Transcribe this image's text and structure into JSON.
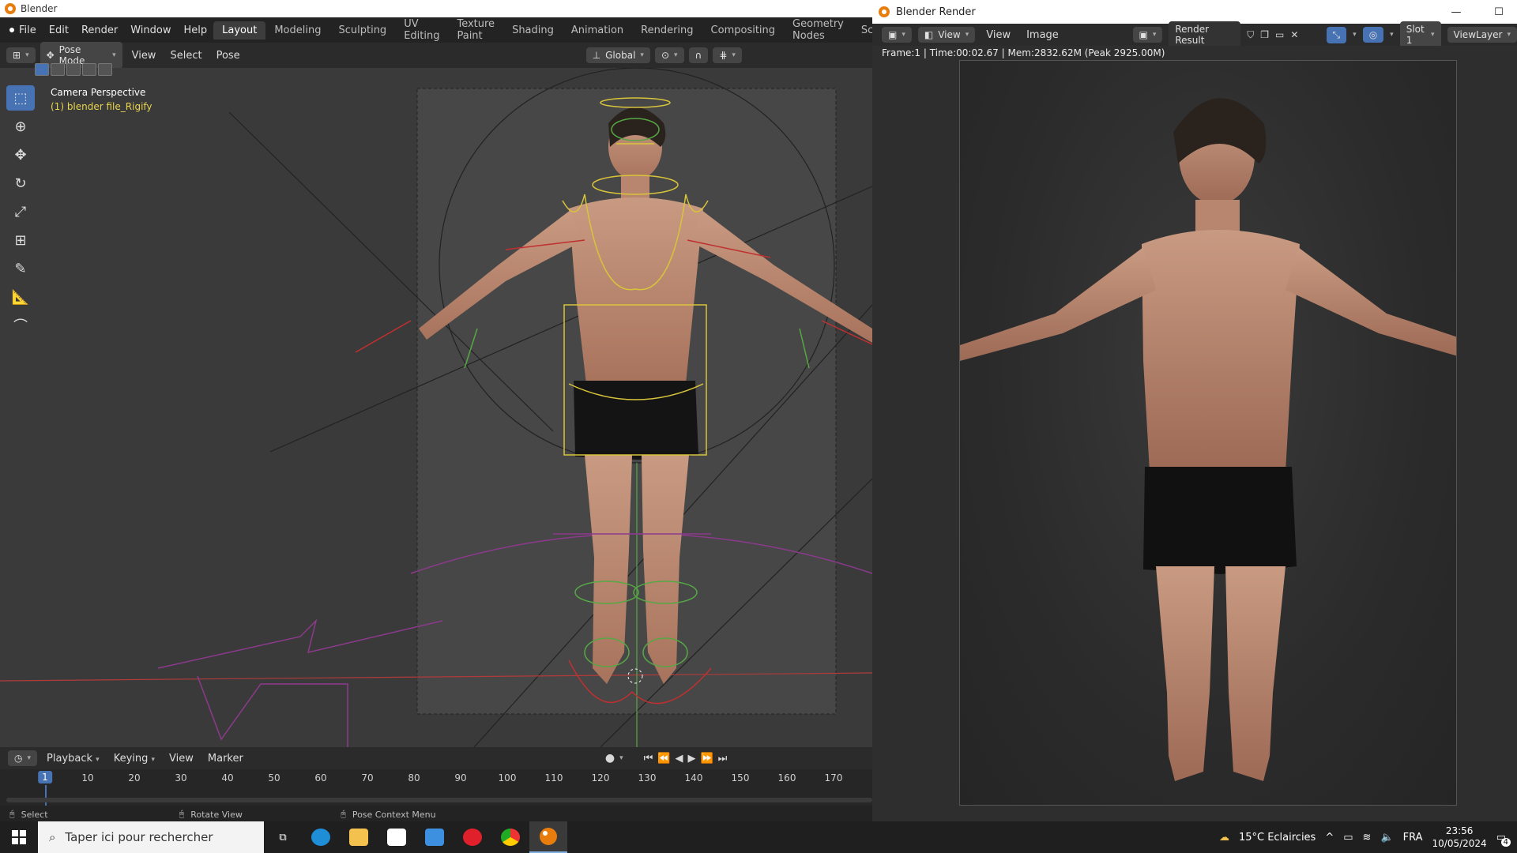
{
  "os_window": {
    "title": "Blender"
  },
  "topbar": {
    "menus": [
      "File",
      "Edit",
      "Render",
      "Window",
      "Help"
    ],
    "workspaces": [
      "Layout",
      "Modeling",
      "Sculpting",
      "UV Editing",
      "Texture Paint",
      "Shading",
      "Animation",
      "Rendering",
      "Compositing",
      "Geometry Nodes",
      "Scripting"
    ],
    "active_workspace": "Layout",
    "add_tab": "+"
  },
  "viewport_header": {
    "mode": "Pose Mode",
    "menus": [
      "View",
      "Select",
      "Pose"
    ],
    "transform_orientation": "Global"
  },
  "viewport": {
    "camera_label": "Camera Perspective",
    "object_label": "(1) blender file_Rigify"
  },
  "timeline": {
    "menus": [
      "Playback",
      "Keying",
      "View",
      "Marker"
    ],
    "current_frame": "1",
    "ticks": [
      "10",
      "20",
      "30",
      "40",
      "50",
      "60",
      "70",
      "80",
      "90",
      "100",
      "110",
      "120",
      "130",
      "140",
      "150",
      "160",
      "170"
    ]
  },
  "statusbar": {
    "items": [
      "Select",
      "Rotate View",
      "Pose Context Menu"
    ]
  },
  "render_window": {
    "title": "Blender Render",
    "menus": [
      "View",
      "View",
      "Image"
    ],
    "image_name": "Render Result",
    "slot": "Slot 1",
    "view_layer": "ViewLayer",
    "info": "Frame:1 | Time:00:02.67 | Mem:2832.62M (Peak 2925.00M)"
  },
  "taskbar": {
    "search_placeholder": "Taper ici pour rechercher",
    "weather": "15°C  Eclaircies",
    "language": "FRA",
    "time": "23:56",
    "date": "10/05/2024",
    "notifications": "4"
  },
  "colors": {
    "accent": "#4772b3",
    "blender_orange": "#e87d0d",
    "highlight_yellow": "#e8d44d"
  }
}
